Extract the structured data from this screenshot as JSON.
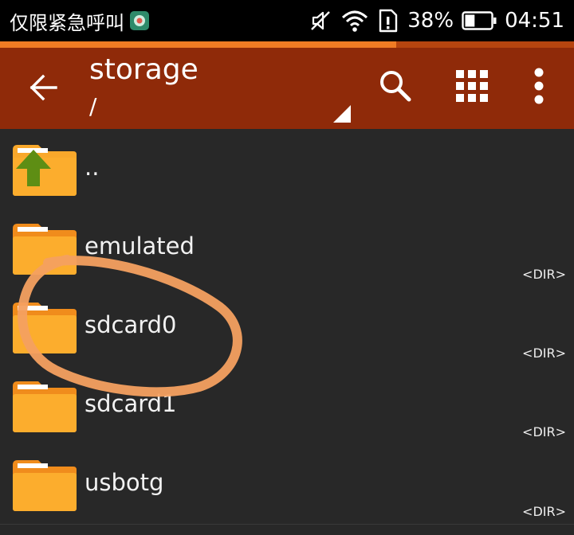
{
  "status_bar": {
    "carrier": "仅限紧急呼叫",
    "battery_percent": "38%",
    "time": "04:51",
    "icons": [
      "app-badge-icon",
      "mute-icon",
      "wifi-icon",
      "sim-alert-icon",
      "battery-icon"
    ]
  },
  "toolbar": {
    "title": "storage",
    "path": "/",
    "progress_fraction": 0.69,
    "icons": [
      "back-arrow-icon",
      "search-icon",
      "grid-view-icon",
      "more-vertical-icon",
      "dropdown-triangle-icon"
    ]
  },
  "files": [
    {
      "name": "..",
      "meta": "",
      "icon": "folder-up-icon"
    },
    {
      "name": "emulated",
      "meta": "<DIR>",
      "icon": "folder-icon"
    },
    {
      "name": "sdcard0",
      "meta": "<DIR>",
      "icon": "folder-icon"
    },
    {
      "name": "sdcard1",
      "meta": "<DIR>",
      "icon": "folder-icon"
    },
    {
      "name": "usbotg",
      "meta": "<DIR>",
      "icon": "folder-icon"
    }
  ],
  "colors": {
    "toolbar": "#8f2a09",
    "progress": "#f07c24",
    "list_bg": "#282828",
    "folder": "#f9a82b",
    "annotation": "#f4a060"
  }
}
